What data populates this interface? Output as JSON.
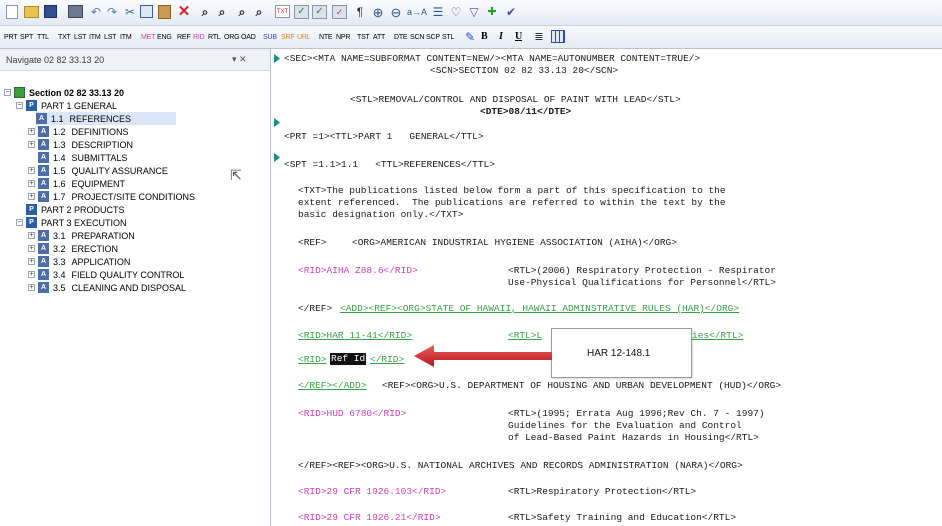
{
  "toolbar1": {
    "icons": [
      "new-doc-icon",
      "open-icon",
      "save-icon",
      "print-icon",
      "undo-icon",
      "redo-icon",
      "cut-icon",
      "copy-icon",
      "paste-icon",
      "delete-icon",
      "find-icon",
      "find-next-icon",
      "replace-icon",
      "replace-all-icon",
      "mark-icon",
      "tag-view-icon",
      "check-icon",
      "check2-icon",
      "spell-icon",
      "pilcrow-icon",
      "zoom-in-icon",
      "zoom-out-icon",
      "sort-icon",
      "list-icon",
      "heart-icon",
      "filter-icon",
      "plus-icon",
      "arrow-icon"
    ]
  },
  "toolbar2": {
    "tags": [
      "PRT",
      "SPT",
      "TTL",
      "TXT",
      "LST",
      "ITM",
      "LST",
      "ITM",
      "MET",
      "ENG",
      "REF",
      "RID",
      "RTL",
      "ORG",
      "OAD",
      "SUB",
      "SRF",
      "URL",
      "NTE",
      "NPR",
      "TST",
      "ATT",
      "DTE",
      "SCN",
      "SCP",
      "STL"
    ],
    "fmt": [
      "B",
      "I",
      "U"
    ]
  },
  "nav": {
    "title": "Navigate 02 82 33.13 20",
    "pin": "▾ ✕",
    "section": "Section 02 82 33.13 20",
    "items": [
      {
        "num": "",
        "label": "PART 1  GENERAL"
      },
      {
        "num": "1.1",
        "label": "REFERENCES"
      },
      {
        "num": "1.2",
        "label": "DEFINITIONS"
      },
      {
        "num": "1.3",
        "label": "DESCRIPTION"
      },
      {
        "num": "1.4",
        "label": "SUBMITTALS"
      },
      {
        "num": "1.5",
        "label": "QUALITY ASSURANCE"
      },
      {
        "num": "1.6",
        "label": "EQUIPMENT"
      },
      {
        "num": "1.7",
        "label": "PROJECT/SITE CONDITIONS"
      },
      {
        "num": "",
        "label": "PART 2  PRODUCTS"
      },
      {
        "num": "",
        "label": "PART 3  EXECUTION"
      },
      {
        "num": "3.1",
        "label": "PREPARATION"
      },
      {
        "num": "3.2",
        "label": "ERECTION"
      },
      {
        "num": "3.3",
        "label": "APPLICATION"
      },
      {
        "num": "3.4",
        "label": "FIELD QUALITY CONTROL"
      },
      {
        "num": "3.5",
        "label": "CLEANING AND DISPOSAL"
      }
    ]
  },
  "editor": {
    "l1": "<SEC><MTA NAME=SUBFORMAT CONTENT=NEW/><MTA NAME=AUTONUMBER CONTENT=TRUE/>",
    "l2": "<SCN>SECTION 02 82 33.13 20</SCN>",
    "l3": "<STL>REMOVAL/CONTROL AND DISPOSAL OF PAINT WITH LEAD</STL>",
    "l4": "<DTE>08/11</DTE>",
    "l5": "<PRT =1><TTL>PART 1   GENERAL</TTL>",
    "l6": "<SPT =1.1>1.1   <TTL>REFERENCES</TTL>",
    "l7": "<TXT>The publications listed below form a part of this specification to the",
    "l8": "extent referenced.  The publications are referred to within the text by the",
    "l9": "basic designation only.</TXT>",
    "l10a": "<REF>",
    "l10b": "<ORG>AMERICAN INDUSTRIAL HYGIENE ASSOCIATION (AIHA)</ORG>",
    "l11a": "<RID>AIHA Z88.6</RID>",
    "l11b": "<RTL>(2006) Respiratory Protection - Respirator",
    "l11c": "Use-Physical Qualifications for Personnel</RTL>",
    "l12a": "</REF>",
    "l12b": "<ADD><REF><ORG>STATE OF HAWAII, HAWAII ADMINSTRATIVE RULES (HAR)</ORG>",
    "l13a": "<RID>HAR 11-41</RID>",
    "l13b": "<RTL>L",
    "l13c": "ies</RTL>",
    "l14a": "<RID>",
    "l14sel": "Ref Id",
    "l14b": "</RID>",
    "l15a": "</REF></ADD>",
    "l15b": "<REF><ORG>U.S. DEPARTMENT OF HOUSING AND URBAN DEVELOPMENT (HUD)</ORG>",
    "l16a": "<RID>HUD 6780</RID>",
    "l16b": "<RTL>(1995; Errata Aug 1996;Rev Ch. 7 - 1997)",
    "l16c": "Guidelines for the Evaluation and Control",
    "l16d": "of Lead-Based Paint Hazards in Housing</RTL>",
    "l17": "</REF><REF><ORG>U.S. NATIONAL ARCHIVES AND RECORDS ADMINISTRATION (NARA)</ORG>",
    "l18a": "<RID>29 CFR 1926.103</RID>",
    "l18b": "<RTL>Respiratory Protection</RTL>",
    "l19a": "<RID>29 CFR 1926.21</RID>",
    "l19b": "<RTL>Safety Training and Education</RTL>"
  },
  "callout": {
    "text": "HAR 12-148.1"
  },
  "colors": {
    "pink": "#d33fb5",
    "green": "#3aa04a",
    "arrow": "#d9262a"
  }
}
